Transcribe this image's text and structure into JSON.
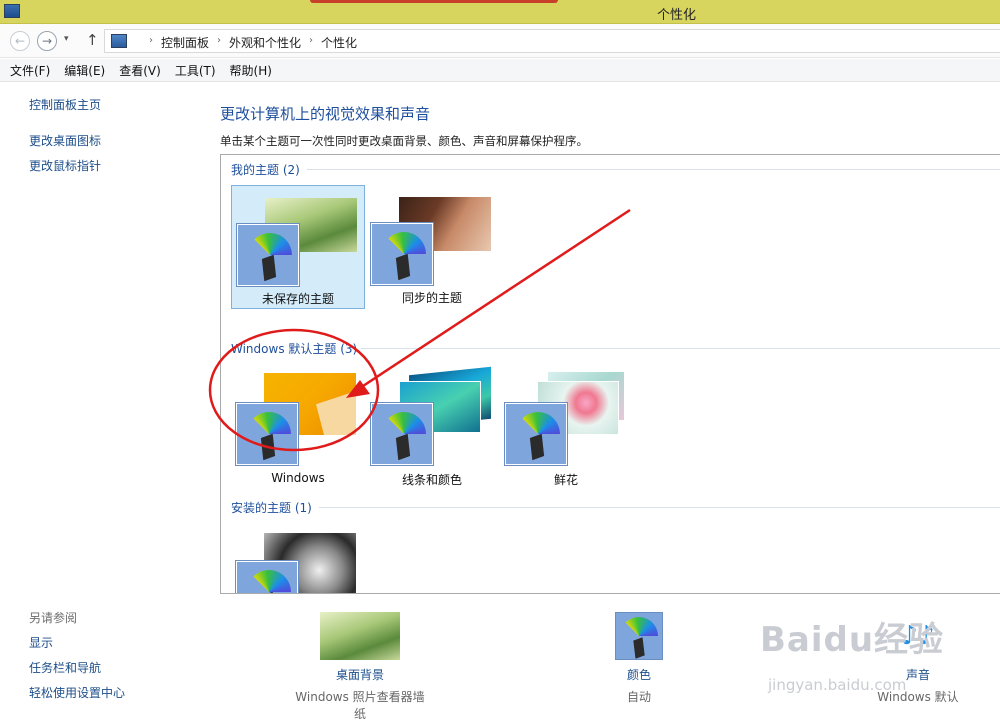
{
  "window": {
    "title": "个性化"
  },
  "address": {
    "breadcrumbs": [
      "控制面板",
      "外观和个性化",
      "个性化"
    ],
    "separator": "›",
    "back_glyph": "←",
    "forward_glyph": "→",
    "dropdown_glyph": "▾",
    "up_glyph": "↑"
  },
  "menu": [
    "文件(F)",
    "编辑(E)",
    "查看(V)",
    "工具(T)",
    "帮助(H)"
  ],
  "sidebar": {
    "home_link": "控制面板主页",
    "links": [
      "更改桌面图标",
      "更改鼠标指针"
    ],
    "see_also_heading": "另请参阅",
    "see_also": [
      "显示",
      "任务栏和导航",
      "轻松使用设置中心"
    ]
  },
  "main": {
    "title": "更改计算机上的视觉效果和声音",
    "description": "单击某个主题可一次性同时更改桌面背景、颜色、声音和屏幕保护程序。"
  },
  "groups": {
    "my_themes": {
      "label": "我的主题 (2)",
      "items": [
        "未保存的主题",
        "同步的主题"
      ]
    },
    "windows_default": {
      "label": "Windows 默认主题 (3)",
      "items": [
        "Windows",
        "线条和颜色",
        "鲜花"
      ]
    },
    "installed": {
      "label": "安装的主题 (1)"
    }
  },
  "bottom": {
    "background": {
      "label": "桌面背景",
      "value": "Windows 照片查看器墙纸"
    },
    "color": {
      "label": "颜色",
      "value": "自动"
    },
    "sound": {
      "label": "声音",
      "value": "Windows 默认"
    }
  },
  "watermark": {
    "text": "Baidu经验",
    "sub": "jingyan.baidu.com"
  },
  "colors": {
    "titlebar": "#d8d55f",
    "link": "#1d4e8a",
    "heading": "#1e4f9c",
    "selection": "#d4ecf9",
    "annotation": "#e01b1b"
  }
}
